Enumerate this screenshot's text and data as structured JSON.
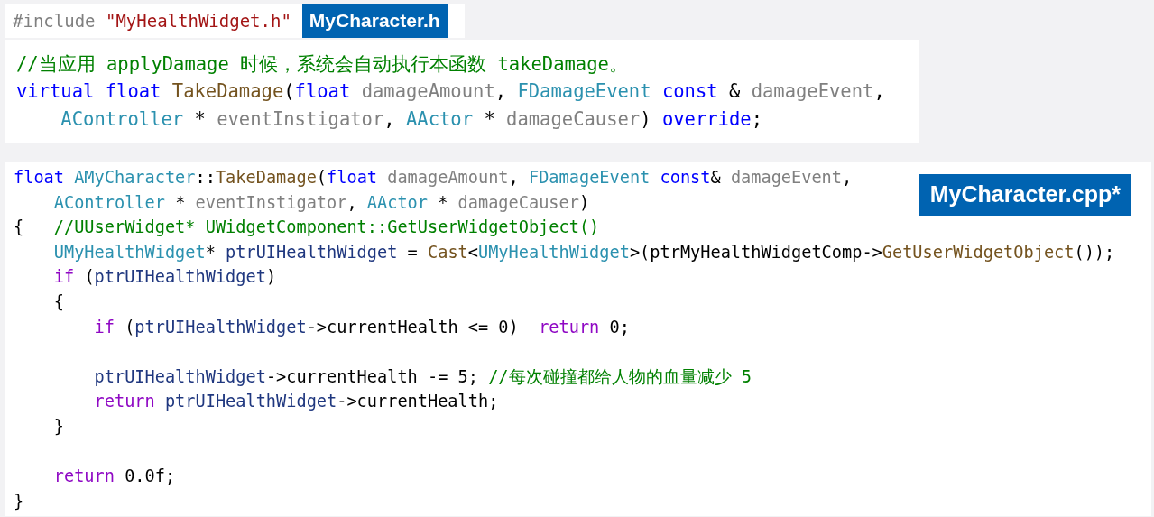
{
  "include_line": {
    "tokens": [
      {
        "kind": "preproc",
        "text": "#include "
      },
      {
        "kind": "str",
        "text": "\"MyHealthWidget.h\""
      }
    ]
  },
  "header_tab": {
    "label": "MyCharacter.h"
  },
  "declaration_snippet": {
    "lines": [
      {
        "kind": "code",
        "tokens": [
          {
            "kind": "comment",
            "text": "//当应用 applyDamage 时候，系统会自动执行本函数 takeDamage。"
          }
        ]
      },
      {
        "kind": "code",
        "tokens": [
          {
            "kind": "kw",
            "text": "virtual float "
          },
          {
            "kind": "fn",
            "text": "TakeDamage"
          },
          {
            "kind": "plain",
            "text": "("
          },
          {
            "kind": "kw",
            "text": "float "
          },
          {
            "kind": "param",
            "text": "damageAmount"
          },
          {
            "kind": "plain",
            "text": ", "
          },
          {
            "kind": "type",
            "text": "FDamageEvent "
          },
          {
            "kind": "kw",
            "text": "const "
          },
          {
            "kind": "plain",
            "text": "& "
          },
          {
            "kind": "param",
            "text": "damageEvent"
          },
          {
            "kind": "plain",
            "text": ","
          }
        ]
      },
      {
        "kind": "code",
        "tokens": [
          {
            "kind": "type",
            "text": "    AController "
          },
          {
            "kind": "plain",
            "text": "* "
          },
          {
            "kind": "param",
            "text": "eventInstigator"
          },
          {
            "kind": "plain",
            "text": ", "
          },
          {
            "kind": "type",
            "text": "AActor "
          },
          {
            "kind": "plain",
            "text": "* "
          },
          {
            "kind": "param",
            "text": "damageCauser"
          },
          {
            "kind": "plain",
            "text": ") "
          },
          {
            "kind": "kw",
            "text": "override"
          },
          {
            "kind": "plain",
            "text": ";"
          }
        ]
      }
    ]
  },
  "source_snippet": {
    "tab": {
      "label": "MyCharacter.cpp*"
    },
    "lines": [
      {
        "kind": "code",
        "tokens": [
          {
            "kind": "kw",
            "text": "float "
          },
          {
            "kind": "type",
            "text": "AMyCharacter"
          },
          {
            "kind": "plain",
            "text": "::"
          },
          {
            "kind": "fn",
            "text": "TakeDamage"
          },
          {
            "kind": "plain",
            "text": "("
          },
          {
            "kind": "kw",
            "text": "float "
          },
          {
            "kind": "param",
            "text": "damageAmount"
          },
          {
            "kind": "plain",
            "text": ", "
          },
          {
            "kind": "type",
            "text": "FDamageEvent "
          },
          {
            "kind": "kw",
            "text": "const"
          },
          {
            "kind": "plain",
            "text": "& "
          },
          {
            "kind": "param",
            "text": "damageEvent"
          },
          {
            "kind": "plain",
            "text": ","
          }
        ]
      },
      {
        "kind": "code",
        "tokens": [
          {
            "kind": "type",
            "text": "    AController "
          },
          {
            "kind": "plain",
            "text": "* "
          },
          {
            "kind": "param",
            "text": "eventInstigator"
          },
          {
            "kind": "plain",
            "text": ", "
          },
          {
            "kind": "type",
            "text": "AActor "
          },
          {
            "kind": "plain",
            "text": "* "
          },
          {
            "kind": "param",
            "text": "damageCauser"
          },
          {
            "kind": "plain",
            "text": ")"
          }
        ]
      },
      {
        "kind": "code",
        "tokens": [
          {
            "kind": "plain",
            "text": "{   "
          },
          {
            "kind": "comment",
            "text": "//UUserWidget* UWidgetComponent::GetUserWidgetObject()"
          }
        ]
      },
      {
        "kind": "code",
        "tokens": [
          {
            "kind": "type",
            "text": "    UMyHealthWidget"
          },
          {
            "kind": "plain",
            "text": "* "
          },
          {
            "kind": "var",
            "text": "ptrUIHealthWidget"
          },
          {
            "kind": "plain",
            "text": " = "
          },
          {
            "kind": "fn",
            "text": "Cast"
          },
          {
            "kind": "plain",
            "text": "<"
          },
          {
            "kind": "type",
            "text": "UMyHealthWidget"
          },
          {
            "kind": "plain",
            "text": ">(ptrMyHealthWidgetComp->"
          },
          {
            "kind": "fn",
            "text": "GetUserWidgetObject"
          },
          {
            "kind": "plain",
            "text": "());"
          }
        ]
      },
      {
        "kind": "code",
        "tokens": [
          {
            "kind": "ctrl",
            "text": "    if "
          },
          {
            "kind": "plain",
            "text": "("
          },
          {
            "kind": "var",
            "text": "ptrUIHealthWidget"
          },
          {
            "kind": "plain",
            "text": ")"
          }
        ]
      },
      {
        "kind": "code",
        "tokens": [
          {
            "kind": "plain",
            "text": "    {"
          }
        ]
      },
      {
        "kind": "code",
        "tokens": [
          {
            "kind": "ctrl",
            "text": "        if "
          },
          {
            "kind": "plain",
            "text": "("
          },
          {
            "kind": "var",
            "text": "ptrUIHealthWidget"
          },
          {
            "kind": "plain",
            "text": "->currentHealth <= 0)  "
          },
          {
            "kind": "ctrl",
            "text": "return "
          },
          {
            "kind": "plain",
            "text": "0;"
          }
        ]
      },
      {
        "kind": "blank"
      },
      {
        "kind": "code",
        "tokens": [
          {
            "kind": "var",
            "text": "        ptrUIHealthWidget"
          },
          {
            "kind": "plain",
            "text": "->currentHealth -= 5; "
          },
          {
            "kind": "comment",
            "text": "//每次碰撞都给人物的血量减少 5"
          }
        ]
      },
      {
        "kind": "code",
        "tokens": [
          {
            "kind": "ctrl",
            "text": "        return "
          },
          {
            "kind": "var",
            "text": "ptrUIHealthWidget"
          },
          {
            "kind": "plain",
            "text": "->currentHealth;"
          }
        ]
      },
      {
        "kind": "code",
        "tokens": [
          {
            "kind": "plain",
            "text": "    }"
          }
        ]
      },
      {
        "kind": "blank"
      },
      {
        "kind": "code",
        "tokens": [
          {
            "kind": "ctrl",
            "text": "    return "
          },
          {
            "kind": "plain",
            "text": "0.0f;"
          }
        ]
      },
      {
        "kind": "code",
        "tokens": [
          {
            "kind": "plain",
            "text": "}"
          }
        ]
      }
    ]
  }
}
